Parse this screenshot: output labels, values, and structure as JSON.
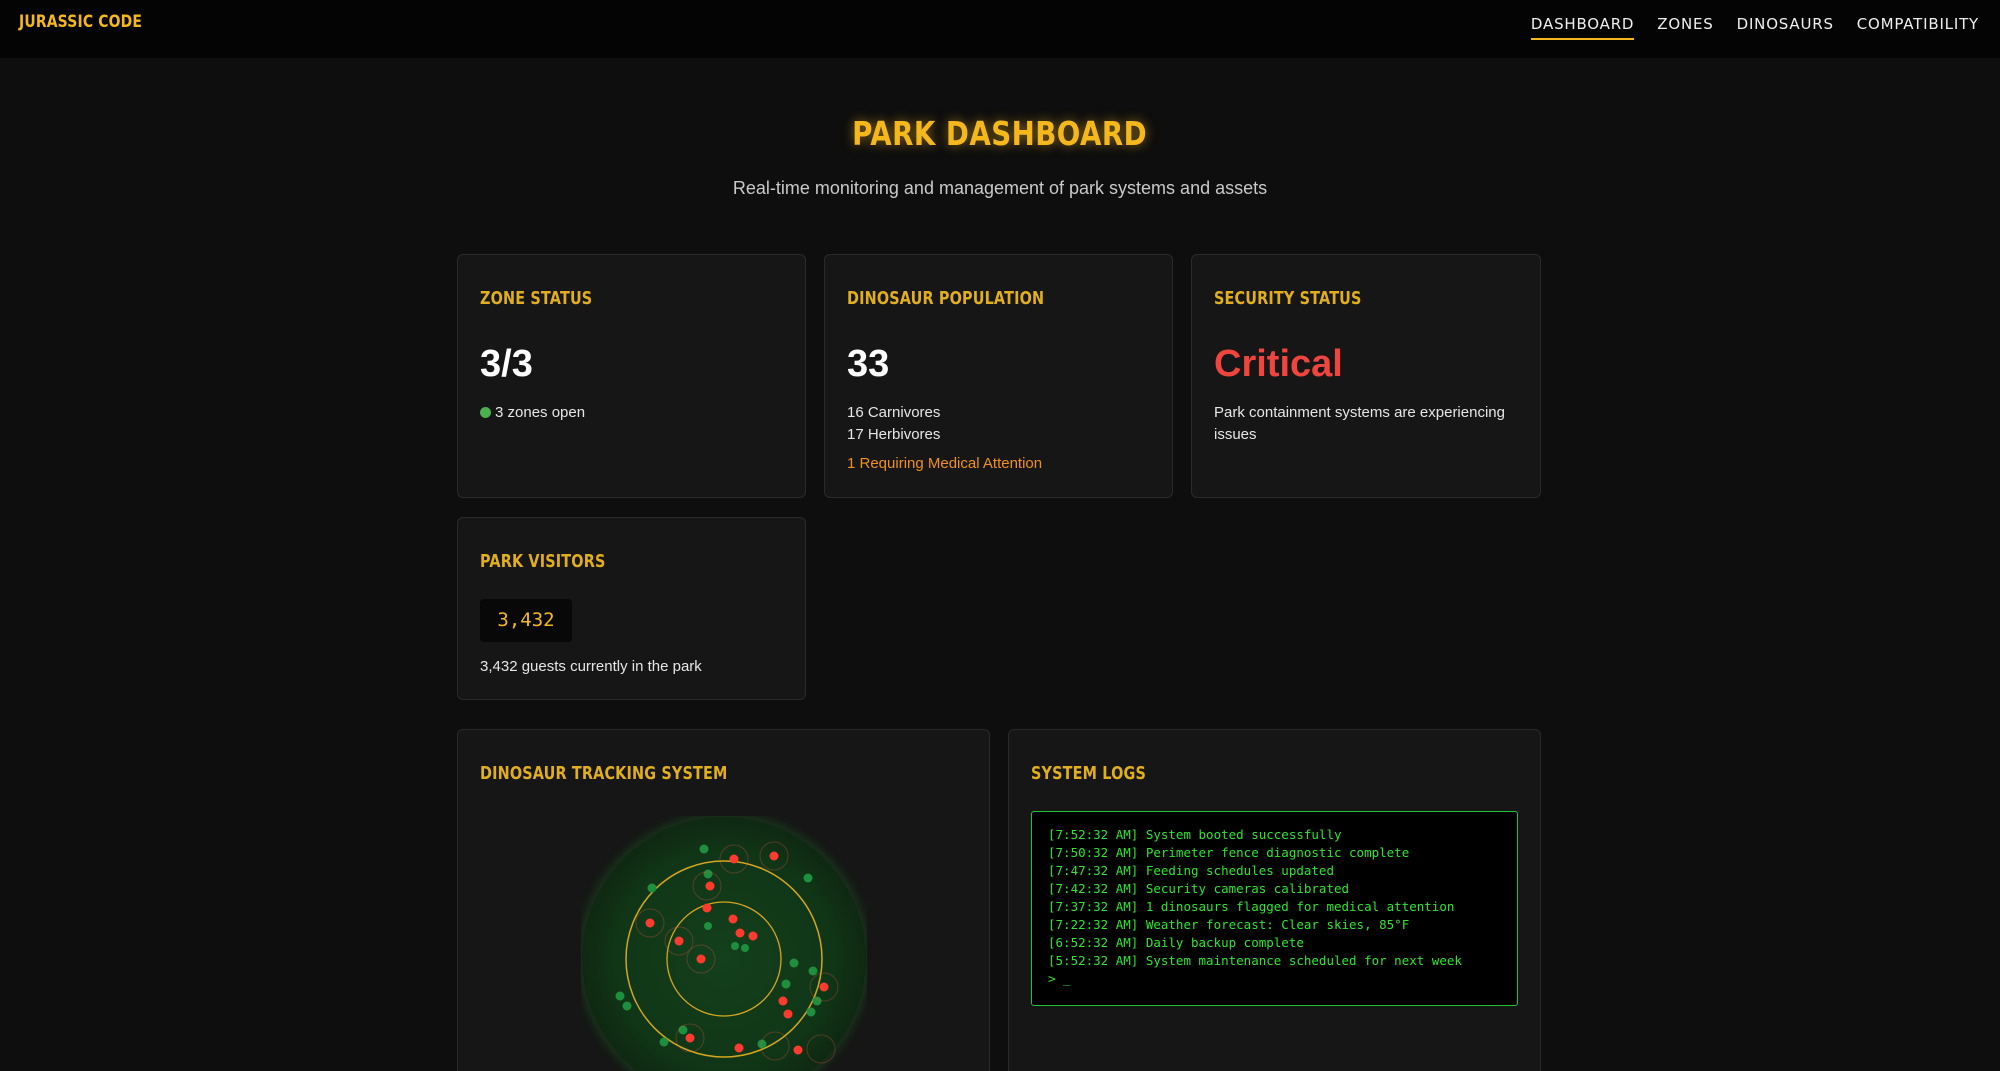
{
  "app": {
    "logo": "JURASSIC CODE"
  },
  "nav": {
    "items": [
      {
        "label": "DASHBOARD",
        "active": true
      },
      {
        "label": "ZONES",
        "active": false
      },
      {
        "label": "DINOSAURS",
        "active": false
      },
      {
        "label": "COMPATIBILITY",
        "active": false
      }
    ]
  },
  "page": {
    "title": "PARK DASHBOARD",
    "subtitle": "Real-time monitoring and management of park systems and assets"
  },
  "zone_status": {
    "title": "ZONE STATUS",
    "value": "3/3",
    "detail": "3 zones open",
    "indicator_color": "#4caf50"
  },
  "population": {
    "title": "DINOSAUR POPULATION",
    "value": "33",
    "carnivores": "16 Carnivores",
    "herbivores": "17 Herbivores",
    "medical": "1 Requiring Medical Attention"
  },
  "security": {
    "title": "SECURITY STATUS",
    "value": "Critical",
    "description": "Park containment systems are experiencing issues",
    "status_color": "#f0453f"
  },
  "visitors": {
    "title": "PARK VISITORS",
    "counter": "3,432",
    "description": "3,432 guests currently in the park"
  },
  "tracking": {
    "title": "DINOSAUR TRACKING SYSTEM",
    "carnivore_color": "#ff3b30",
    "herbivore_color": "#1e8f3e"
  },
  "logs": {
    "title": "SYSTEM LOGS",
    "lines": [
      "[7:52:32 AM] System booted successfully",
      "[7:50:32 AM] Perimeter fence diagnostic complete",
      "[7:47:32 AM] Feeding schedules updated",
      "[7:42:32 AM] Security cameras calibrated",
      "[7:37:32 AM] 1 dinosaurs flagged for medical attention",
      "[7:22:32 AM] Weather forecast: Clear skies, 85°F",
      "[6:52:32 AM] Daily backup complete",
      "[5:52:32 AM] System maintenance scheduled for next week"
    ],
    "prompt": "> _"
  },
  "colors": {
    "accent": "#f5b81c",
    "background": "#0e0e0e",
    "card": "#161616",
    "terminal_text": "#2ee62e",
    "warning": "#f0901e"
  }
}
